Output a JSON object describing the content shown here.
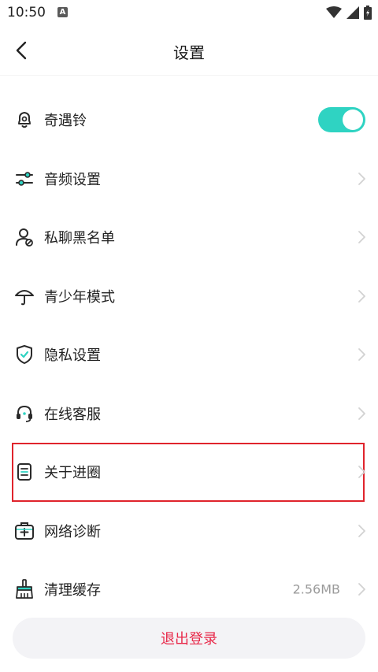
{
  "status_bar": {
    "time": "10:50",
    "notification_letter": "A"
  },
  "nav": {
    "title": "设置"
  },
  "items": [
    {
      "label": "奇遇铃",
      "icon": "bell-icon",
      "control": "toggle",
      "toggle_on": true
    },
    {
      "label": "音频设置",
      "icon": "sliders-icon"
    },
    {
      "label": "私聊黑名单",
      "icon": "user-block-icon"
    },
    {
      "label": "青少年模式",
      "icon": "umbrella-icon"
    },
    {
      "label": "隐私设置",
      "icon": "shield-check-icon"
    },
    {
      "label": "在线客服",
      "icon": "headset-icon"
    },
    {
      "label": "关于进圈",
      "icon": "document-icon",
      "highlighted": true
    },
    {
      "label": "网络诊断",
      "icon": "medkit-icon"
    },
    {
      "label": "清理缓存",
      "icon": "broom-icon",
      "value": "2.56MB"
    }
  ],
  "logout": {
    "label": "退出登录"
  },
  "colors": {
    "accent": "#2fd3c2",
    "danger": "#e8294a",
    "highlight_border": "#e0242c"
  }
}
